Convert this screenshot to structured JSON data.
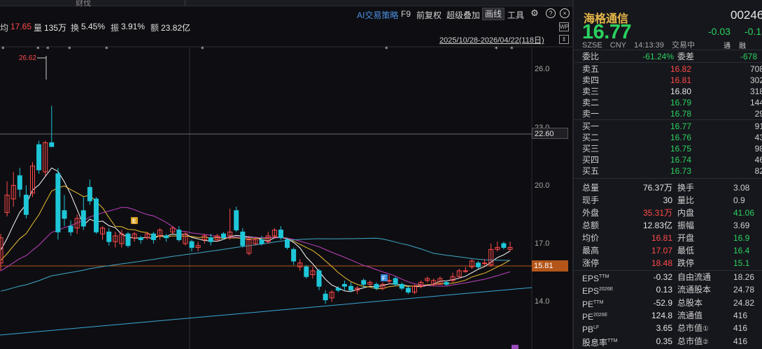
{
  "top_tab": "财伐",
  "toolbar": {
    "ai_strategy": "AI交易策略",
    "f9": "F9",
    "fuquan": "前复权",
    "overlay": "超级叠加",
    "draw_line": "画线",
    "tools": "工具",
    "help": "?",
    "close": "×"
  },
  "info": {
    "avg_label": "均",
    "avg_value": "17.65",
    "vol_label": "量",
    "vol_value": "135万",
    "turnover_label": "换",
    "turnover_value": "5.45%",
    "amplitude_label": "振",
    "amplitude_value": "3.91%",
    "amount_label": "额",
    "amount_value": "23.82亿"
  },
  "date_range": "2025/10/28-2026/04/22(118日)",
  "side_icons": [
    "WP",
    "⇕"
  ],
  "chart_data": {
    "type": "candlestick",
    "y_axis_ticks": [
      "26.0",
      "23.0",
      "20.0",
      "17.0",
      "14.0"
    ],
    "high_annotation": "26.62",
    "price_tags": [
      "22.60",
      "15.81"
    ],
    "markers": [
      "E",
      "F"
    ],
    "candles": [
      {
        "o": 16.0,
        "c": 17.3,
        "h": 17.5,
        "l": 15.6
      },
      {
        "o": 18.6,
        "c": 19.5,
        "h": 20.2,
        "l": 18.4
      },
      {
        "o": 19.3,
        "c": 20.0,
        "h": 20.7,
        "l": 18.9
      },
      {
        "o": 20.5,
        "c": 19.8,
        "h": 20.9,
        "l": 19.4
      },
      {
        "o": 19.5,
        "c": 18.5,
        "h": 20.0,
        "l": 18.3
      },
      {
        "o": 19.6,
        "c": 21.0,
        "h": 21.2,
        "l": 19.4
      },
      {
        "o": 22.1,
        "c": 20.8,
        "h": 22.3,
        "l": 20.6
      },
      {
        "o": 20.7,
        "c": 22.2,
        "h": 22.3,
        "l": 20.5
      },
      {
        "o": 22.2,
        "c": 22.0,
        "h": 24.1,
        "l": 22.0
      },
      {
        "o": 20.6,
        "c": 17.6,
        "h": 20.9,
        "l": 17.2
      },
      {
        "o": 18.7,
        "c": 18.3,
        "h": 19.5,
        "l": 17.9
      },
      {
        "o": 17.9,
        "c": 17.6,
        "h": 18.2,
        "l": 17.4
      },
      {
        "o": 17.8,
        "c": 18.3,
        "h": 18.5,
        "l": 17.5
      },
      {
        "o": 18.7,
        "c": 17.9,
        "h": 19.4,
        "l": 17.7
      },
      {
        "o": 19.9,
        "c": 19.2,
        "h": 20.3,
        "l": 19.0
      },
      {
        "o": 19.3,
        "c": 17.6,
        "h": 19.4,
        "l": 17.5
      },
      {
        "o": 17.5,
        "c": 17.8,
        "h": 17.9,
        "l": 17.2
      },
      {
        "o": 17.6,
        "c": 17.1,
        "h": 17.8,
        "l": 16.9
      },
      {
        "o": 17.1,
        "c": 17.4,
        "h": 17.6,
        "l": 16.8
      },
      {
        "o": 17.0,
        "c": 17.5,
        "h": 17.7,
        "l": 16.8
      },
      {
        "o": 17.5,
        "c": 16.9,
        "h": 17.6,
        "l": 16.8
      },
      {
        "o": 17.3,
        "c": 17.5,
        "h": 17.6,
        "l": 17.1
      },
      {
        "o": 17.3,
        "c": 17.2,
        "h": 17.4,
        "l": 17.0
      },
      {
        "o": 17.3,
        "c": 17.5,
        "h": 17.6,
        "l": 17.2
      },
      {
        "o": 17.5,
        "c": 17.2,
        "h": 17.6,
        "l": 17.0
      },
      {
        "o": 17.4,
        "c": 17.7,
        "h": 17.8,
        "l": 17.2
      },
      {
        "o": 17.4,
        "c": 17.3,
        "h": 17.5,
        "l": 17.1
      },
      {
        "o": 17.6,
        "c": 17.8,
        "h": 17.9,
        "l": 17.5
      },
      {
        "o": 17.7,
        "c": 17.2,
        "h": 17.9,
        "l": 17.1
      },
      {
        "o": 17.0,
        "c": 17.5,
        "h": 17.6,
        "l": 16.9
      },
      {
        "o": 17.1,
        "c": 16.8,
        "h": 17.2,
        "l": 16.6
      },
      {
        "o": 16.8,
        "c": 16.9,
        "h": 17.1,
        "l": 16.6
      },
      {
        "o": 17.2,
        "c": 17.4,
        "h": 17.5,
        "l": 17.0
      },
      {
        "o": 17.3,
        "c": 17.1,
        "h": 17.5,
        "l": 16.9
      },
      {
        "o": 17.2,
        "c": 17.4,
        "h": 17.5,
        "l": 17.1
      },
      {
        "o": 17.5,
        "c": 17.3,
        "h": 17.6,
        "l": 17.2
      },
      {
        "o": 17.4,
        "c": 17.6,
        "h": 18.8,
        "l": 17.2
      },
      {
        "o": 18.7,
        "c": 17.7,
        "h": 18.9,
        "l": 17.6
      },
      {
        "o": 17.6,
        "c": 16.9,
        "h": 17.8,
        "l": 16.8
      },
      {
        "o": 16.5,
        "c": 17.2,
        "h": 17.4,
        "l": 16.4
      },
      {
        "o": 17.0,
        "c": 17.2,
        "h": 17.3,
        "l": 16.9
      },
      {
        "o": 17.2,
        "c": 17.0,
        "h": 17.4,
        "l": 16.9
      },
      {
        "o": 17.1,
        "c": 17.4,
        "h": 17.6,
        "l": 17.0
      },
      {
        "o": 17.4,
        "c": 17.7,
        "h": 17.8,
        "l": 17.3
      },
      {
        "o": 17.7,
        "c": 17.3,
        "h": 17.9,
        "l": 17.2
      },
      {
        "o": 17.2,
        "c": 16.8,
        "h": 17.3,
        "l": 16.7
      },
      {
        "o": 16.7,
        "c": 16.1,
        "h": 16.8,
        "l": 15.9
      },
      {
        "o": 15.8,
        "c": 16.0,
        "h": 16.2,
        "l": 15.6
      },
      {
        "o": 15.8,
        "c": 15.3,
        "h": 15.9,
        "l": 15.2
      },
      {
        "o": 15.4,
        "c": 15.6,
        "h": 15.8,
        "l": 15.2
      },
      {
        "o": 15.6,
        "c": 14.8,
        "h": 15.7,
        "l": 14.6
      },
      {
        "o": 14.4,
        "c": 14.1,
        "h": 14.6,
        "l": 13.9
      },
      {
        "o": 14.2,
        "c": 14.5,
        "h": 14.6,
        "l": 14.0
      },
      {
        "o": 14.7,
        "c": 14.6,
        "h": 14.8,
        "l": 14.5
      },
      {
        "o": 14.9,
        "c": 14.8,
        "h": 15.1,
        "l": 14.6
      },
      {
        "o": 14.8,
        "c": 14.6,
        "h": 15.0,
        "l": 14.5
      },
      {
        "o": 14.6,
        "c": 14.7,
        "h": 14.8,
        "l": 14.4
      },
      {
        "o": 15.1,
        "c": 14.9,
        "h": 15.2,
        "l": 14.7
      },
      {
        "o": 14.9,
        "c": 15.0,
        "h": 15.1,
        "l": 14.8
      },
      {
        "o": 14.9,
        "c": 14.7,
        "h": 15.0,
        "l": 14.6
      },
      {
        "o": 14.7,
        "c": 14.9,
        "h": 15.0,
        "l": 14.6
      },
      {
        "o": 15.1,
        "c": 15.1,
        "h": 15.4,
        "l": 14.9
      },
      {
        "o": 15.2,
        "c": 14.9,
        "h": 15.3,
        "l": 14.8
      },
      {
        "o": 14.9,
        "c": 14.7,
        "h": 15.0,
        "l": 14.6
      },
      {
        "o": 14.7,
        "c": 14.5,
        "h": 14.8,
        "l": 14.4
      },
      {
        "o": 14.5,
        "c": 14.8,
        "h": 14.9,
        "l": 14.4
      },
      {
        "o": 14.8,
        "c": 15.0,
        "h": 15.1,
        "l": 14.7
      },
      {
        "o": 15.1,
        "c": 15.2,
        "h": 15.3,
        "l": 15.0
      },
      {
        "o": 14.9,
        "c": 15.1,
        "h": 15.2,
        "l": 14.8
      },
      {
        "o": 14.9,
        "c": 15.2,
        "h": 15.3,
        "l": 14.9
      },
      {
        "o": 15.0,
        "c": 14.9,
        "h": 15.1,
        "l": 14.8
      },
      {
        "o": 15.1,
        "c": 15.3,
        "h": 15.5,
        "l": 15.0
      },
      {
        "o": 15.3,
        "c": 15.6,
        "h": 15.7,
        "l": 15.2
      },
      {
        "o": 15.6,
        "c": 15.6,
        "h": 15.8,
        "l": 15.5
      },
      {
        "o": 15.8,
        "c": 16.1,
        "h": 16.2,
        "l": 15.7
      },
      {
        "o": 16.0,
        "c": 15.8,
        "h": 16.1,
        "l": 15.7
      },
      {
        "o": 16.0,
        "c": 16.0,
        "h": 16.2,
        "l": 15.9
      },
      {
        "o": 15.9,
        "c": 16.7,
        "h": 17.0,
        "l": 15.8
      },
      {
        "o": 16.7,
        "c": 16.8,
        "h": 17.1,
        "l": 16.6
      },
      {
        "o": 17.0,
        "c": 16.8,
        "h": 17.1,
        "l": 16.7
      },
      {
        "o": 16.7,
        "c": 16.8,
        "h": 17.1,
        "l": 16.6
      }
    ]
  },
  "quote": {
    "name": "海格通信",
    "code": "00246",
    "price": "16.77",
    "change": "-0.03",
    "change_pct": "-0.18",
    "market": "SZSE",
    "currency": "CNY",
    "time": "14:13:39",
    "status": "交易中",
    "tag_tong": "通",
    "tag_rong": "融",
    "weibi_label": "委比",
    "weibi_value": "-61.24%",
    "weicha_label": "委差",
    "weicha_value": "-678",
    "asks": [
      {
        "label": "卖五",
        "price": "16.82",
        "vol": "708",
        "color": "red"
      },
      {
        "label": "卖四",
        "price": "16.81",
        "vol": "302",
        "color": "red"
      },
      {
        "label": "卖三",
        "price": "16.80",
        "vol": "318",
        "color": "white"
      },
      {
        "label": "卖二",
        "price": "16.79",
        "vol": "144",
        "color": "green"
      },
      {
        "label": "卖一",
        "price": "16.78",
        "vol": "29",
        "color": "green"
      }
    ],
    "bids": [
      {
        "label": "买一",
        "price": "16.77",
        "vol": "91",
        "color": "green"
      },
      {
        "label": "买二",
        "price": "16.76",
        "vol": "43",
        "color": "green"
      },
      {
        "label": "买三",
        "price": "16.75",
        "vol": "98",
        "color": "green"
      },
      {
        "label": "买四",
        "price": "16.74",
        "vol": "46",
        "color": "green"
      },
      {
        "label": "买五",
        "price": "16.73",
        "vol": "82",
        "color": "green"
      }
    ],
    "stats": [
      {
        "l1": "总量",
        "v1": "76.37万",
        "c1": "white",
        "l2": "换手",
        "v2": "3.08",
        "c2": "white"
      },
      {
        "l1": "现手",
        "v1": "30",
        "c1": "white",
        "l2": "量比",
        "v2": "0.9",
        "c2": "white"
      },
      {
        "l1": "外盘",
        "v1": "35.31万",
        "c1": "red",
        "l2": "内盘",
        "v2": "41.06",
        "c2": "green"
      },
      {
        "l1": "总额",
        "v1": "12.83亿",
        "c1": "white",
        "l2": "振幅",
        "v2": "3.69",
        "c2": "white"
      },
      {
        "l1": "均价",
        "v1": "16.81",
        "c1": "red",
        "l2": "开盘",
        "v2": "16.9",
        "c2": "green"
      },
      {
        "l1": "最高",
        "v1": "17.07",
        "c1": "red",
        "l2": "最低",
        "v2": "16.4",
        "c2": "green"
      },
      {
        "l1": "涨停",
        "v1": "18.48",
        "c1": "red",
        "l2": "跌停",
        "v2": "15.1",
        "c2": "green"
      }
    ],
    "fund": [
      {
        "l1": "EPS",
        "s1": "TTM",
        "v1": "-0.32",
        "l2": "自由流通",
        "s2": "",
        "v2": "18.26"
      },
      {
        "l1": "EPS",
        "s1": "2026E",
        "v1": "0.13",
        "l2": "流通股本",
        "s2": "",
        "v2": "24.78"
      },
      {
        "l1": "PE",
        "s1": "TTM",
        "v1": "-52.9",
        "l2": "总股本",
        "s2": "",
        "v2": "24.82"
      },
      {
        "l1": "PE",
        "s1": "2026E",
        "v1": "124.8",
        "l2": "流通值",
        "s2": "",
        "v2": "416"
      },
      {
        "l1": "PB",
        "s1": "LF",
        "v1": "3.65",
        "l2": "总市值",
        "s2": "①",
        "v2": "416"
      },
      {
        "l1": "股息率",
        "s1": "TTM",
        "v1": "0.35",
        "l2": "总市值",
        "s2": "②",
        "v2": "416"
      }
    ]
  },
  "colors": {
    "up": "#ff4a4a",
    "down": "#1fc6d8",
    "ma5": "#ffffff",
    "ma10": "#f0c030",
    "ma20": "#c040c0",
    "ma60": "#40a8c8"
  }
}
